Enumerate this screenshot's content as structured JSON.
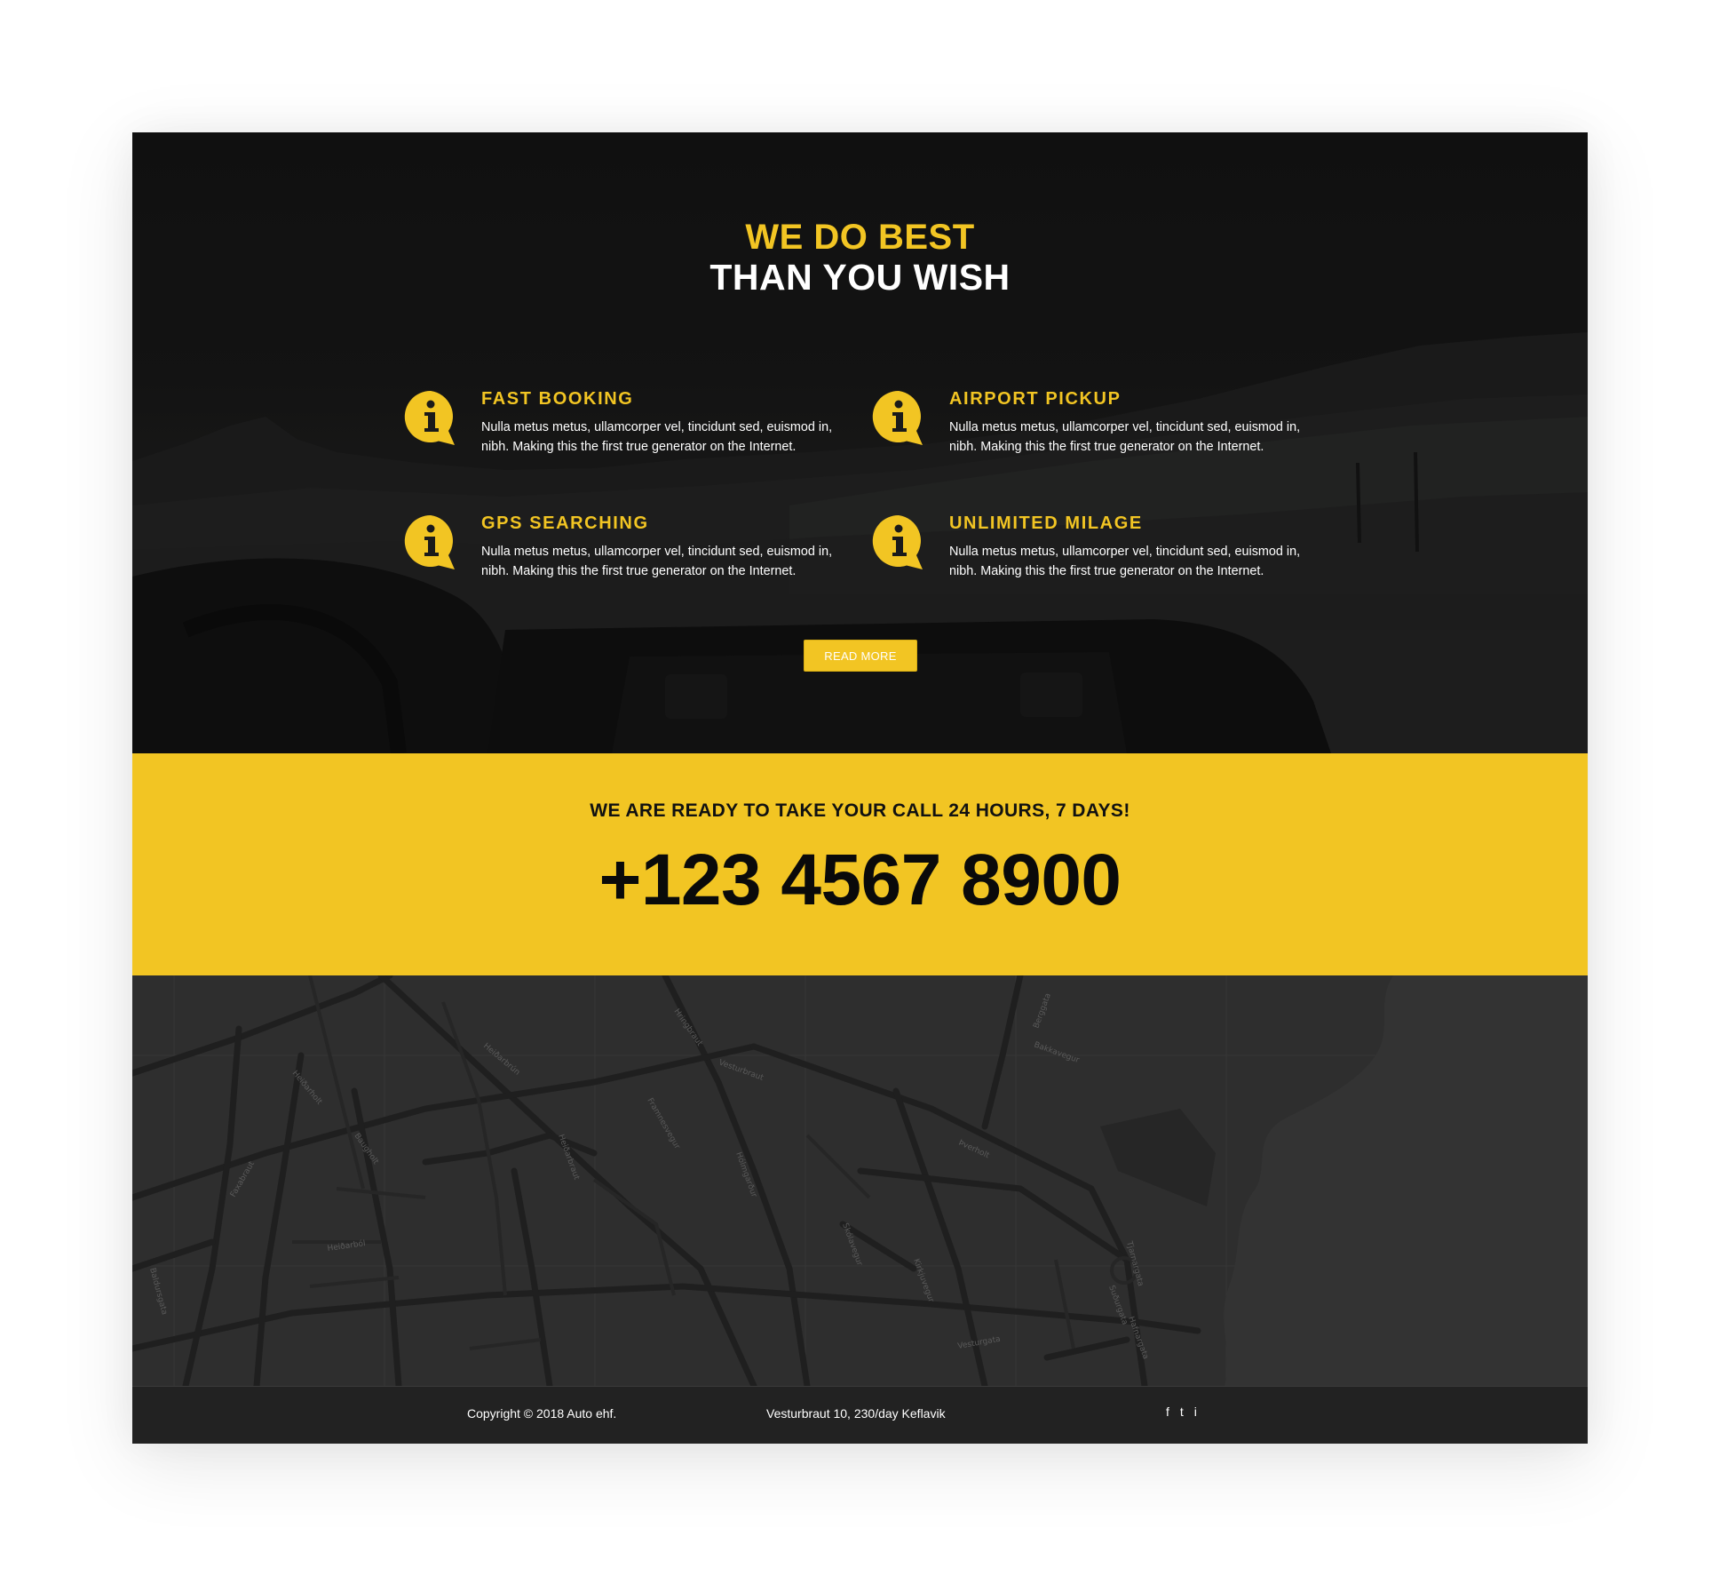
{
  "hero": {
    "heading_line1": "WE DO BEST",
    "heading_line2": "THAN YOU WISH",
    "features": [
      {
        "icon": "info-bubble-icon",
        "title": "FAST BOOKING",
        "text": "Nulla metus metus, ullamcorper vel, tincidunt sed, euismod in, nibh. Making this the first true generator on the Internet."
      },
      {
        "icon": "info-bubble-icon",
        "title": "AIRPORT PICKUP",
        "text": "Nulla metus metus, ullamcorper vel, tincidunt sed, euismod in, nibh. Making this the first true generator on the Internet."
      },
      {
        "icon": "info-bubble-icon",
        "title": "GPS SEARCHING",
        "text": "Nulla metus metus, ullamcorper vel, tincidunt sed, euismod in, nibh. Making this the first true generator on the Internet."
      },
      {
        "icon": "info-bubble-icon",
        "title": "UNLIMITED MILAGE",
        "text": "Nulla metus metus, ullamcorper vel, tincidunt sed, euismod in, nibh. Making this the first true generator on the Internet."
      }
    ],
    "read_more_label": "READ MORE"
  },
  "call_band": {
    "tagline": "WE ARE READY TO TAKE YOUR CALL 24 HOURS, 7 DAYS!",
    "phone": "+123 4567 8900"
  },
  "map": {
    "street_labels": [
      "Heiðarholt",
      "Heiðarból",
      "Hringbraut",
      "Vesturbraut",
      "Baugholt",
      "Heiðarbraut",
      "Faxabraut",
      "Vesturgata",
      "Þverholt",
      "Baldursgata",
      "Hólmgarður",
      "Heiðarbrún",
      "Kirkjuvegur",
      "Suðurgata",
      "Skólavegur",
      "Tjarnargata",
      "Hafnargata",
      "Berggata",
      "Framnesvegur",
      "Bakkavegur"
    ]
  },
  "footer": {
    "copyright": "Copyright © 2018 Auto ehf.",
    "address": "Vesturbraut 10, 230/day Keflavik",
    "social": [
      "f",
      "t",
      "i"
    ]
  },
  "colors": {
    "accent": "#f2c523",
    "hero_bg": "#171717",
    "map_bg": "#2e2e2e",
    "footer_bg": "#222222"
  }
}
